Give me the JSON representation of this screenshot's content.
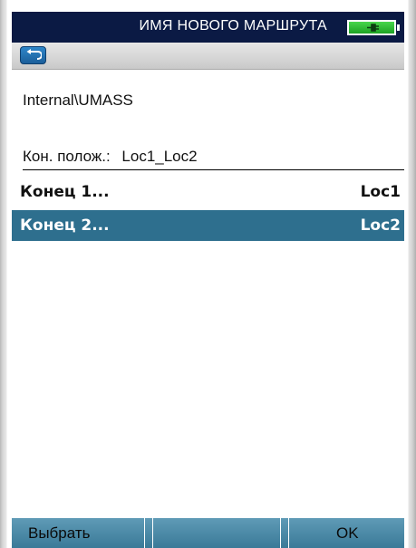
{
  "titlebar": {
    "title": "ИМЯ НОВОГО МАРШРУТА",
    "battery_icon": "battery-charging-icon",
    "battery_color": "#2fbf35"
  },
  "toolbar": {
    "back_icon": "back-arrow-icon"
  },
  "content": {
    "path": "Internal\\UMASS",
    "end_position": {
      "label": "Кон. полож.:",
      "value": "Loc1_Loc2"
    },
    "items": [
      {
        "name": "Конец 1...",
        "value": "Loc1",
        "selected": false
      },
      {
        "name": "Конец 2...",
        "value": "Loc2",
        "selected": true
      }
    ],
    "selection_color": "#2e6f8e"
  },
  "softkeys": {
    "left_label": "Выбрать",
    "middle_label": "",
    "right_label": "OK"
  },
  "colors": {
    "titlebar_bg": "#0b1a44",
    "softbar_bg": "#4a89a7"
  }
}
